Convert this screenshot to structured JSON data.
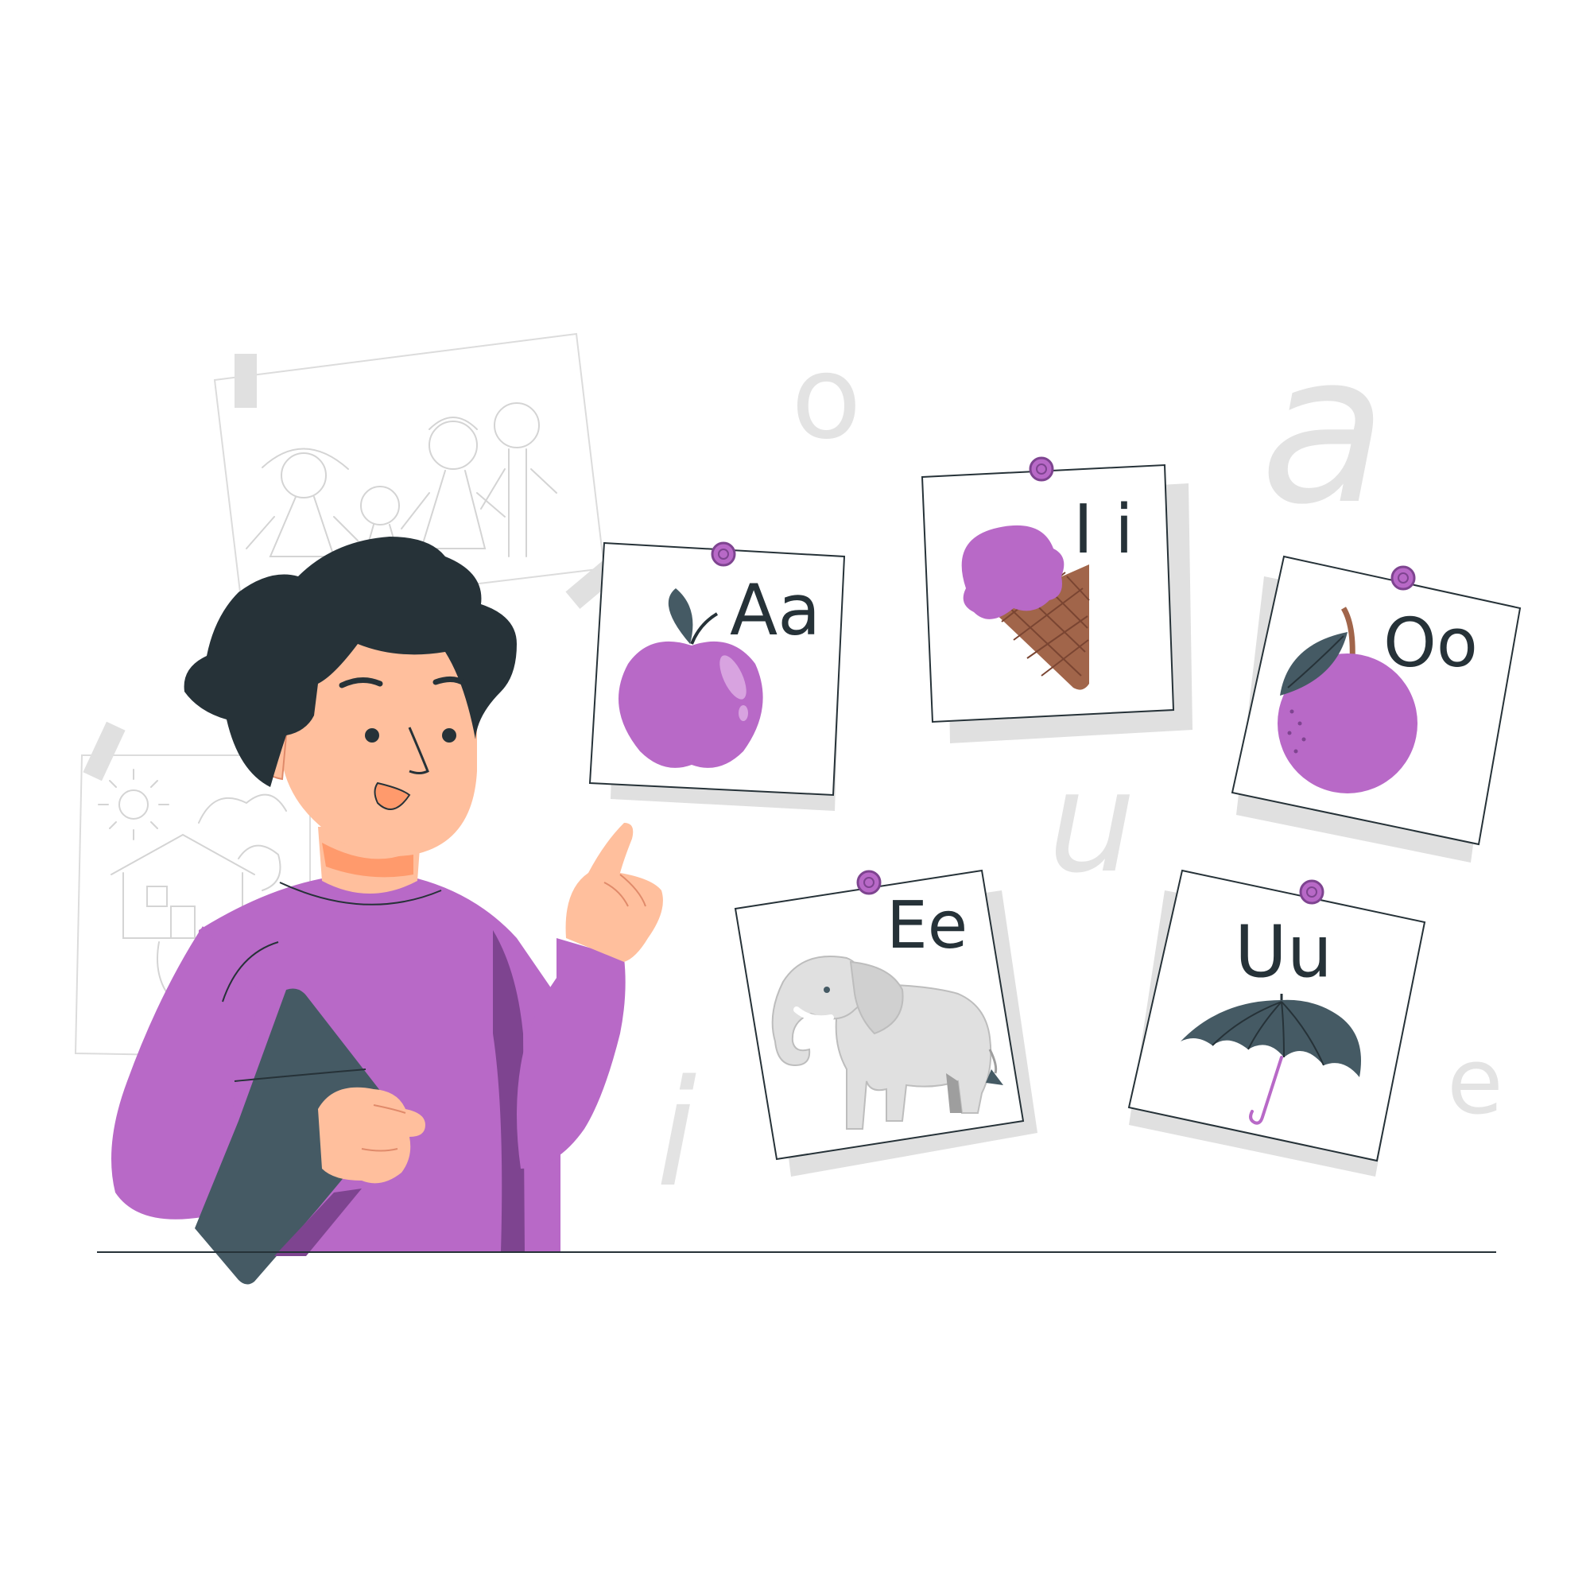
{
  "illustration": {
    "colors": {
      "purple": "#b869c7",
      "purple_dark": "#7e4490",
      "dark": "#263238",
      "slate": "#455a64",
      "skin": "#ffbf9d",
      "skin_shadow": "#ff9a6c",
      "card_shadow": "#e0e0e0",
      "background_letter": "#e3e3e3",
      "sketch_line": "#d6d6d6",
      "cone": "#a1654a"
    },
    "background_letters": [
      "o",
      "a",
      "u",
      "i",
      "e"
    ],
    "cards": [
      {
        "label": "Aa",
        "picture": "apple-icon"
      },
      {
        "label": "I i",
        "picture": "ice-cream-icon"
      },
      {
        "label": "Oo",
        "picture": "plum-icon"
      },
      {
        "label": "Ee",
        "picture": "elephant-icon"
      },
      {
        "label": "Uu",
        "picture": "umbrella-icon"
      }
    ]
  }
}
